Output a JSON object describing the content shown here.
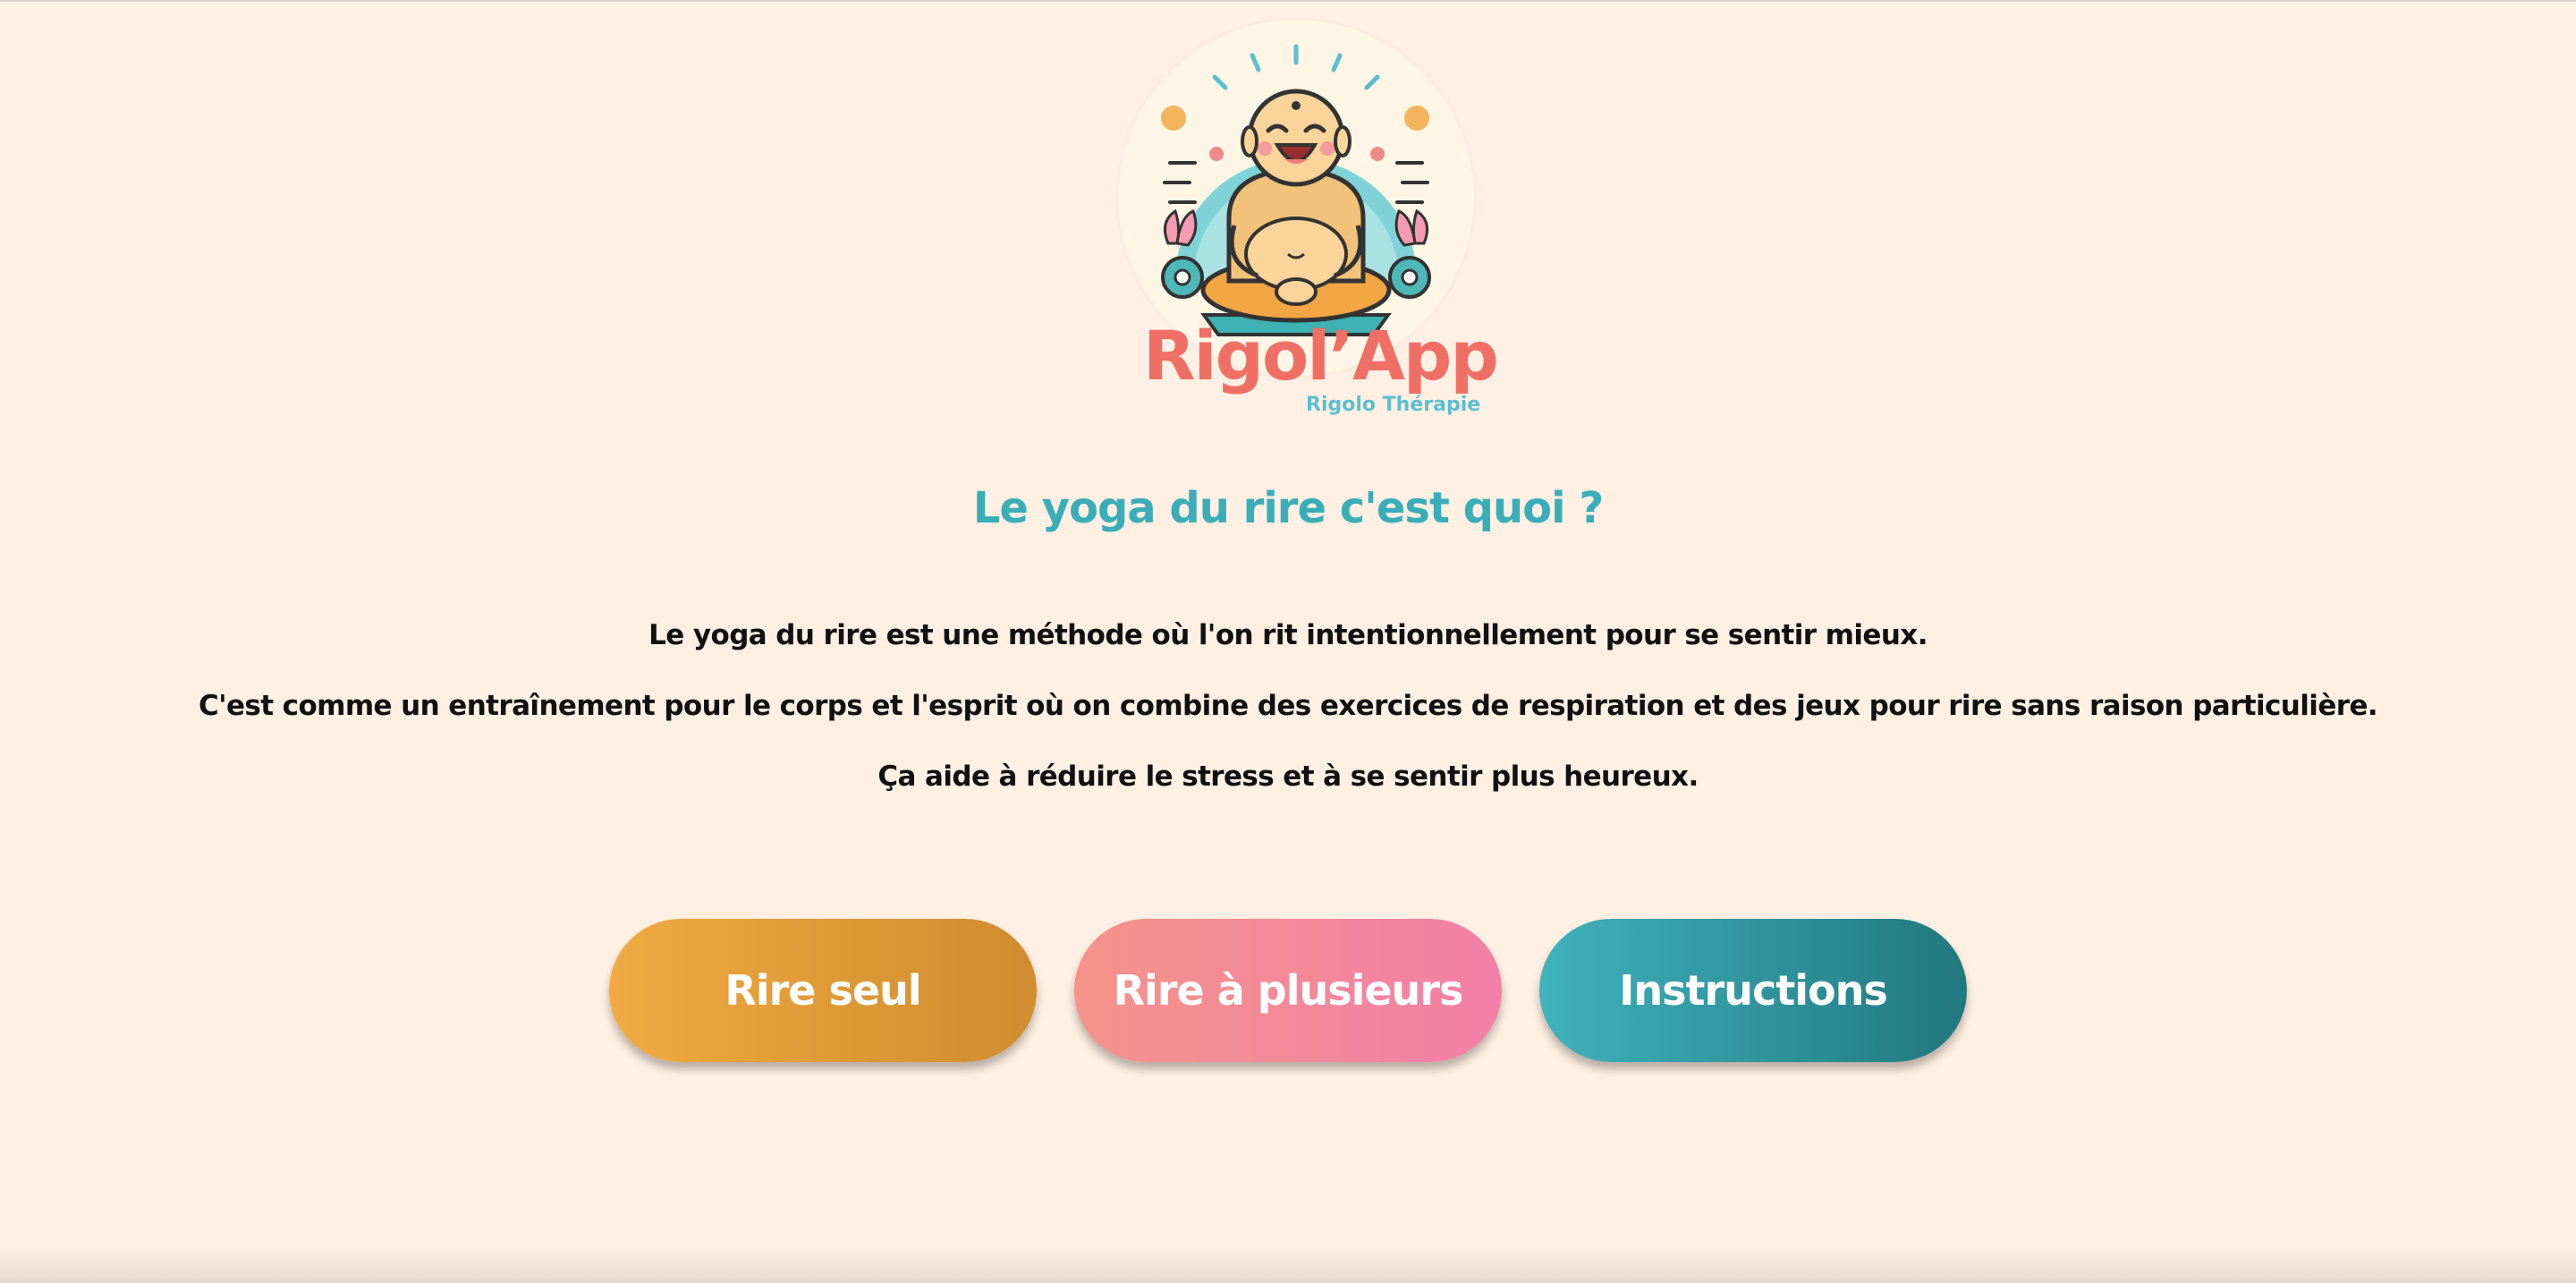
{
  "logo": {
    "name": "Rigol’App",
    "tagline": "Rigolo Thérapie",
    "icon": "laughing-buddha-icon"
  },
  "intro": {
    "title": "Le yoga du rire c'est quoi ?",
    "paragraphs": [
      "Le yoga du rire est une méthode où l'on rit intentionnellement pour se sentir mieux.",
      "C'est comme un entraînement pour le corps et l'esprit où on combine des exercices de respiration et des jeux pour rire sans raison particulière.",
      "Ça aide à réduire le stress et à se sentir plus heureux."
    ]
  },
  "actions": {
    "solo": "Rire seul",
    "group": "Rire à plusieurs",
    "instructions": "Instructions"
  },
  "colors": {
    "background": "#fff0e3",
    "title": "#3aaeb8",
    "solo_button": "#e09a38",
    "group_button": "#f48a98",
    "instructions_button": "#2e949d",
    "logo_name": "#ef6f66",
    "logo_tagline": "#5bbfd0"
  }
}
